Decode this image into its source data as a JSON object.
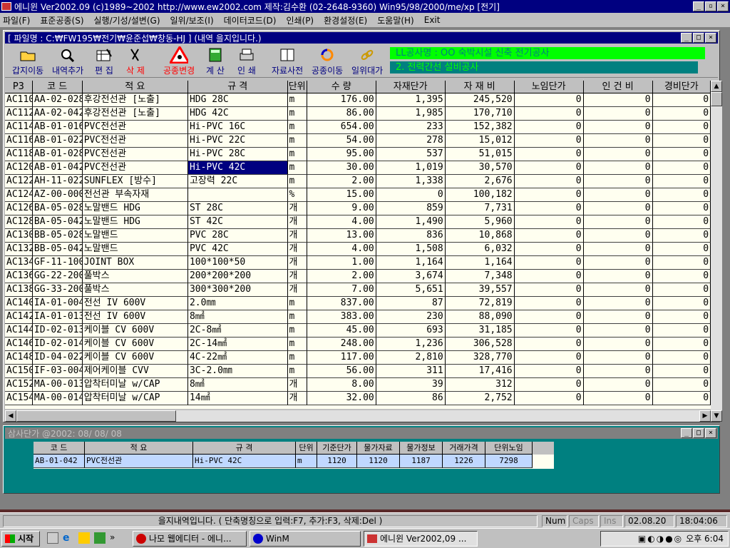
{
  "window": {
    "title": "에니윈 Ver2002.09 (c)1989~2002 http://www.ew2002.com 제작:김수환 (02-2648-9360) Win95/98/2000/me/xp [전기]"
  },
  "menu": [
    "파일(F)",
    "표준공종(S)",
    "실행/기성/설변(G)",
    "일위/보조(I)",
    "데이터코드(D)",
    "인쇄(P)",
    "환경설정(E)",
    "도움말(H)",
    "Exit"
  ],
  "child1": {
    "title": "[ 파일명 : C:₩FW195₩전기₩윤준섭₩창동-HJ ] (내역 을지입니다.)"
  },
  "toolbar": [
    {
      "label": "갑지이동",
      "icon": "folder-open-icon",
      "color": "#000080"
    },
    {
      "label": "내역추가",
      "icon": "magnifier-icon",
      "color": "#000080"
    },
    {
      "label": "편 집",
      "icon": "edit-table-icon",
      "color": "#000080"
    },
    {
      "label": "삭 제",
      "icon": "scissors-icon",
      "color": "#ff0000"
    },
    {
      "label": "공종변경",
      "icon": "warning-sign-icon",
      "color": "#ff0000"
    },
    {
      "label": "계 산",
      "icon": "calculator-icon",
      "color": "#000080"
    },
    {
      "label": "인 쇄",
      "icon": "printer-icon",
      "color": "#000080"
    },
    {
      "label": "자료사전",
      "icon": "book-icon",
      "color": "#000080"
    },
    {
      "label": "공종이동",
      "icon": "circle-arrows-icon",
      "color": "#000080"
    },
    {
      "label": "일위대가",
      "icon": "chain-link-icon",
      "color": "#000080"
    }
  ],
  "project": {
    "name": "LL공사명 : OO 숙박시설 신축 전기공사",
    "section": "2. 전력간선 설비공사"
  },
  "grid": {
    "columns": [
      "P3",
      "코  드",
      "적    요",
      "규    격",
      "단위",
      "수  량",
      "자재단가",
      "자 재 비",
      "노임단가",
      "인 건 비",
      "경비단가"
    ],
    "rows": [
      [
        "AC110",
        "AA-02-028",
        "후강전선관 [노출]",
        "HDG 28C",
        "m",
        "176.00",
        "1,395",
        "245,520",
        "0",
        "0",
        "0"
      ],
      [
        "AC112",
        "AA-02-042",
        "후강전선관 [노출]",
        "HDG 42C",
        "m",
        "86.00",
        "1,985",
        "170,710",
        "0",
        "0",
        "0"
      ],
      [
        "AC114",
        "AB-01-016",
        "PVC전선관",
        "Hi-PVC 16C",
        "m",
        "654.00",
        "233",
        "152,382",
        "0",
        "0",
        "0"
      ],
      [
        "AC116",
        "AB-01-022",
        "PVC전선관",
        "Hi-PVC 22C",
        "m",
        "54.00",
        "278",
        "15,012",
        "0",
        "0",
        "0"
      ],
      [
        "AC118",
        "AB-01-028",
        "PVC전선관",
        "Hi-PVC 28C",
        "m",
        "95.00",
        "537",
        "51,015",
        "0",
        "0",
        "0"
      ],
      [
        "AC120",
        "AB-01-042",
        "PVC전선관",
        "Hi-PVC 42C",
        "m",
        "30.00",
        "1,019",
        "30,570",
        "0",
        "0",
        "0"
      ],
      [
        "AC122",
        "AH-11-022",
        "SUNFLEX [방수]",
        "고장력 22C",
        "m",
        "2.00",
        "1,338",
        "2,676",
        "0",
        "0",
        "0"
      ],
      [
        "AC124",
        "AZ-00-000",
        "전선관 부속자재",
        "",
        "%",
        "15.00",
        "0",
        "100,182",
        "0",
        "0",
        "0"
      ],
      [
        "AC126",
        "BA-05-028",
        "노말밴드      HDG",
        "ST 28C",
        "개",
        "9.00",
        "859",
        "7,731",
        "0",
        "0",
        "0"
      ],
      [
        "AC128",
        "BA-05-042",
        "노말밴드      HDG",
        "ST 42C",
        "개",
        "4.00",
        "1,490",
        "5,960",
        "0",
        "0",
        "0"
      ],
      [
        "AC130",
        "BB-05-028",
        "노말밴드",
        "PVC 28C",
        "개",
        "13.00",
        "836",
        "10,868",
        "0",
        "0",
        "0"
      ],
      [
        "AC132",
        "BB-05-042",
        "노말밴드",
        "PVC 42C",
        "개",
        "4.00",
        "1,508",
        "6,032",
        "0",
        "0",
        "0"
      ],
      [
        "AC134",
        "GF-11-100",
        "JOINT BOX",
        "100*100*50",
        "개",
        "1.00",
        "1,164",
        "1,164",
        "0",
        "0",
        "0"
      ],
      [
        "AC136",
        "GG-22-200",
        "풀박스",
        "200*200*200",
        "개",
        "2.00",
        "3,674",
        "7,348",
        "0",
        "0",
        "0"
      ],
      [
        "AC138",
        "GG-33-200",
        "풀박스",
        "300*300*200",
        "개",
        "7.00",
        "5,651",
        "39,557",
        "0",
        "0",
        "0"
      ],
      [
        "AC140",
        "IA-01-004",
        "전선      IV 600V",
        "2.0㎜",
        "m",
        "837.00",
        "87",
        "72,819",
        "0",
        "0",
        "0"
      ],
      [
        "AC142",
        "IA-01-013",
        "전선      IV 600V",
        "8㎟",
        "m",
        "383.00",
        "230",
        "88,090",
        "0",
        "0",
        "0"
      ],
      [
        "AC144",
        "ID-02-013",
        "케이블    CV 600V",
        "2C-8㎟",
        "m",
        "45.00",
        "693",
        "31,185",
        "0",
        "0",
        "0"
      ],
      [
        "AC146",
        "ID-02-014",
        "케이블    CV 600V",
        "2C-14㎟",
        "m",
        "248.00",
        "1,236",
        "306,528",
        "0",
        "0",
        "0"
      ],
      [
        "AC148",
        "ID-04-022",
        "케이블    CV 600V",
        "4C-22㎟",
        "m",
        "117.00",
        "2,810",
        "328,770",
        "0",
        "0",
        "0"
      ],
      [
        "AC150",
        "IF-03-004",
        "제어케이블    CVV",
        "3C-2.0㎜",
        "m",
        "56.00",
        "311",
        "17,416",
        "0",
        "0",
        "0"
      ],
      [
        "AC152",
        "MA-00-013",
        "압착터미날  w/CAP",
        "8㎟",
        "개",
        "8.00",
        "39",
        "312",
        "0",
        "0",
        "0"
      ],
      [
        "AC154",
        "MA-00-014",
        "압착터미날  w/CAP",
        "14㎟",
        "개",
        "32.00",
        "86",
        "2,752",
        "0",
        "0",
        "0"
      ]
    ]
  },
  "child2": {
    "title": "삼사단가  @2002: 08/ 08/ 08",
    "columns": [
      "코  드",
      "적    요",
      "규    격",
      "단위",
      "기준단가",
      "물가자료",
      "물가정보",
      "거래가격",
      "단위노임"
    ],
    "row": [
      "AB-01-042",
      "PVC전선관",
      "Hi-PVC 42C",
      "m",
      "1120",
      "1120",
      "1187",
      "1226",
      "7298"
    ]
  },
  "status": {
    "message": "을지내역입니다. ( 단축명칭으로 입력:F7,  추가:F3,  삭제:Del )",
    "num": "Num",
    "caps": "Caps",
    "ins": "Ins",
    "date": "02.08.20",
    "time": "18:04:06"
  },
  "taskbar": {
    "start": "시작",
    "items": [
      "나모 웹에디터 - 에니...",
      "WinM",
      "에니윈 Ver2002,09 ..."
    ],
    "clock": "오후 6:04"
  }
}
